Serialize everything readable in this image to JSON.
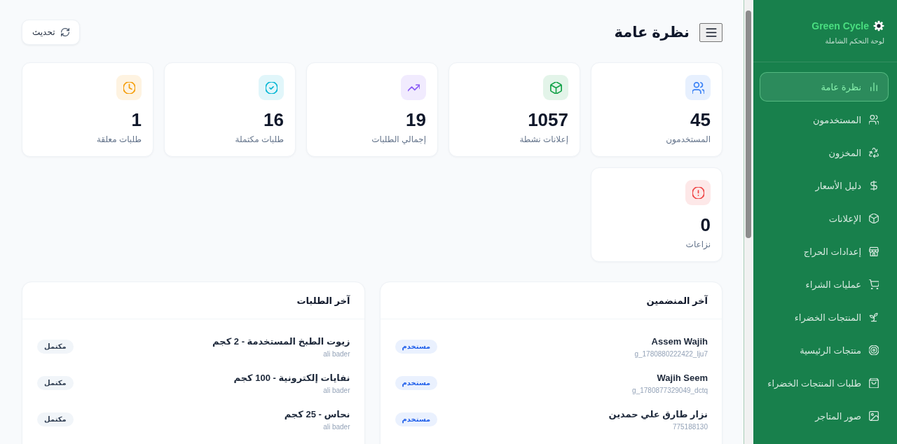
{
  "sidebar": {
    "brand": "Green Cycle",
    "subtitle": "لوحة التحكم الشاملة",
    "items": [
      {
        "label": "نظرة عامة",
        "selected": true
      },
      {
        "label": "المستخدمون",
        "selected": false
      },
      {
        "label": "المخزون",
        "selected": false
      },
      {
        "label": "دليل الأسعار",
        "selected": false
      },
      {
        "label": "الإعلانات",
        "selected": false
      },
      {
        "label": "إعدادات الحراج",
        "selected": false
      },
      {
        "label": "عمليات الشراء",
        "selected": false
      },
      {
        "label": "المنتجات الخضراء",
        "selected": false
      },
      {
        "label": "منتجات الرئيسية",
        "selected": false
      },
      {
        "label": "طلبات المنتجات الخضراء",
        "selected": false
      },
      {
        "label": "صور المتاجر",
        "selected": false
      }
    ]
  },
  "header": {
    "title": "نظرة عامة",
    "refresh_button": "تحديث"
  },
  "stats": [
    {
      "value": "45",
      "label": "المستخدمون",
      "color": "#3b82f6"
    },
    {
      "value": "1057",
      "label": "إعلانات نشطة",
      "color": "#16a34a"
    },
    {
      "value": "19",
      "label": "إجمالي الطلبات",
      "color": "#8b5cf6"
    },
    {
      "value": "16",
      "label": "طلبات مكتملة",
      "color": "#06b6d4"
    },
    {
      "value": "1",
      "label": "طلبات معلقة",
      "color": "#f59e0b"
    },
    {
      "value": "0",
      "label": "نزاعات",
      "color": "#ef4444"
    }
  ],
  "recent_members": {
    "title": "آخر المنضمين",
    "rows": [
      {
        "name": "Assem Wajih",
        "id": "g_1780880222422_lju7",
        "badge": "مستخدم"
      },
      {
        "name": "Wajih Seem",
        "id": "g_1780877329049_dctq",
        "badge": "مستخدم"
      },
      {
        "name": "نزار طارق علي حمدين",
        "id": "775188130",
        "badge": "مستخدم"
      }
    ]
  },
  "recent_orders": {
    "title": "آخر الطلبات",
    "rows": [
      {
        "title": "زيوت الطبخ المستخدمة - 2 كجم",
        "user": "ali bader",
        "status": "مكتمل"
      },
      {
        "title": "نفايات إلكترونية - 100 كجم",
        "user": "ali bader",
        "status": "مكتمل"
      },
      {
        "title": "نحاس - 25 كجم",
        "user": "ali bader",
        "status": "مكتمل"
      }
    ]
  }
}
